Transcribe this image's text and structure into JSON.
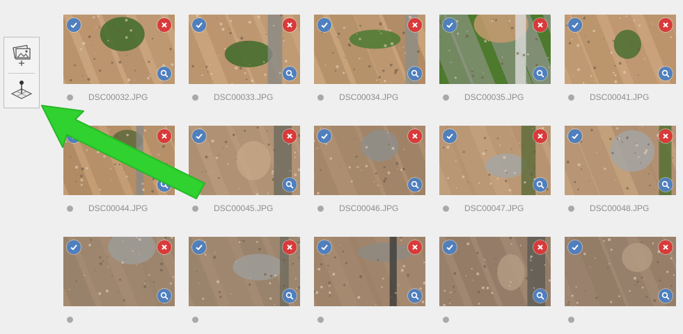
{
  "toolbar": {
    "add_images_icon": "add-images-icon",
    "gcp_icon": "gcp-map-pin-icon"
  },
  "images": [
    {
      "name": "DSC00032.JPG",
      "thumb": "sand-road-trees"
    },
    {
      "name": "DSC00033.JPG",
      "thumb": "sand-road-trees"
    },
    {
      "name": "DSC00034.JPG",
      "thumb": "sand-trees"
    },
    {
      "name": "DSC00035.JPG",
      "thumb": "road-field"
    },
    {
      "name": "DSC00041.JPG",
      "thumb": "sand-curve"
    },
    {
      "name": "DSC00044.JPG",
      "thumb": "sand-road"
    },
    {
      "name": "DSC00045.JPG",
      "thumb": "dirt-tracks"
    },
    {
      "name": "DSC00046.JPG",
      "thumb": "dirt-rubble"
    },
    {
      "name": "DSC00047.JPG",
      "thumb": "sand-rubble"
    },
    {
      "name": "DSC00048.JPG",
      "thumb": "sand-rubble-trees"
    },
    {
      "name": "",
      "thumb": "rubble-lot"
    },
    {
      "name": "",
      "thumb": "rubble-lot"
    },
    {
      "name": "",
      "thumb": "dirt-lot-car"
    },
    {
      "name": "",
      "thumb": "dirt-ridges"
    },
    {
      "name": "",
      "thumb": "dirt-ridges"
    }
  ],
  "colors": {
    "check_badge": "#4f7fbd",
    "remove_badge": "#d83a3a",
    "status_dot": "#a9a9a9",
    "arrow": "#2fd22f"
  }
}
